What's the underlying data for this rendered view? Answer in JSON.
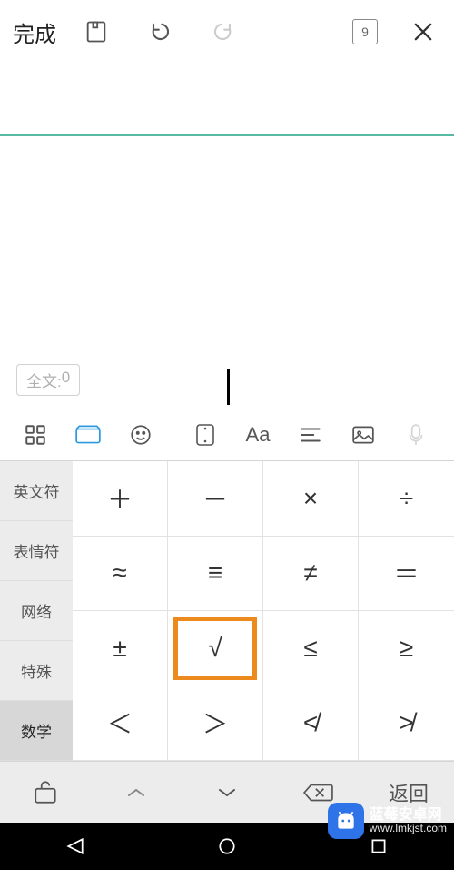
{
  "topbar": {
    "done_label": "完成",
    "page_number": "9"
  },
  "word_count": {
    "prefix": "全文: ",
    "value": "0"
  },
  "sym_categories": [
    "英文符",
    "表情符",
    "网络",
    "特殊",
    "数学"
  ],
  "sym_selected_index": 4,
  "sym_grid": [
    "＋",
    "－",
    "×",
    "÷",
    "≈",
    "≡",
    "≠",
    "＝",
    "±",
    "√",
    "≤",
    "≥",
    "＜",
    "＞",
    "≮",
    "≯"
  ],
  "sym_highlight_index": 9,
  "bottombar": {
    "return_label": "返回"
  },
  "watermark": {
    "line1": "蓝莓安卓网",
    "line2": "www.lmkjst.com"
  }
}
